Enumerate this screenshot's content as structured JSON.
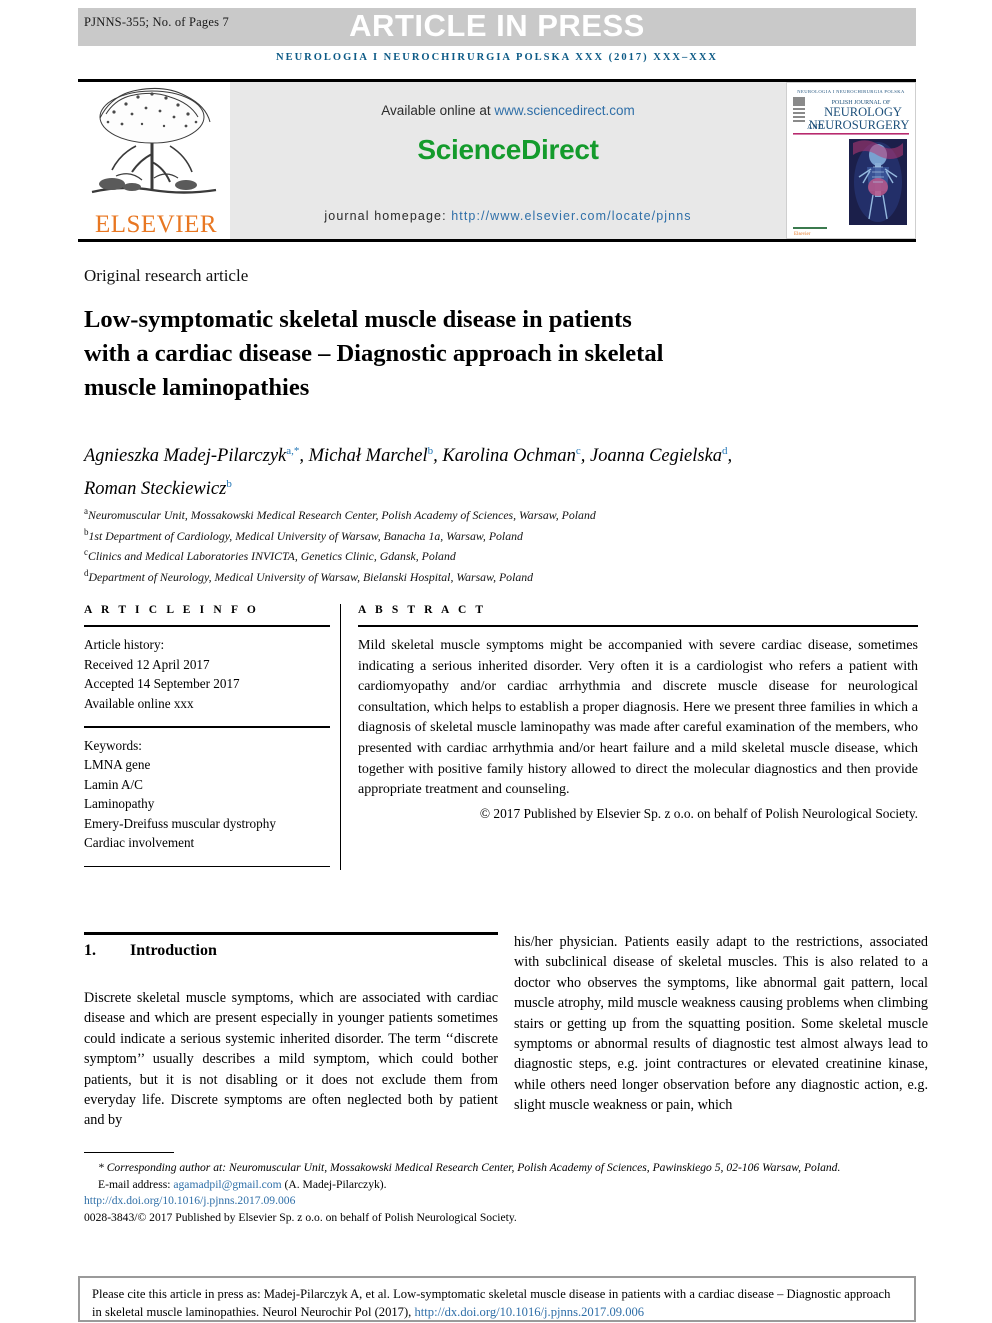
{
  "press_band": {
    "manuscript_id": "PJNNS-355; No. of Pages 7",
    "status": "ARTICLE IN PRESS"
  },
  "running_head": "NEUROLOGIA I NEUROCHIRURGIA POLSKA XXX (2017) XXX–XXX",
  "masthead": {
    "publisher": "ELSEVIER",
    "available_online": "Available online at",
    "sciencedirect_url": "www.sciencedirect.com",
    "sciencedirect_logo": "ScienceDirect",
    "homepage_label": "journal homepage:",
    "homepage_url": "http://www.elsevier.com/locate/pjnns",
    "cover": {
      "top_line": "NEUROLOGIA I NEUROCHIRURGIA POLSKA",
      "line1": "POLISH JOURNAL OF",
      "line2": "NEUROLOGY",
      "line3": "AND",
      "line4": "NEUROSURGERY",
      "footer": "Elsevier"
    }
  },
  "article": {
    "type": "Original research article",
    "title": "Low-symptomatic skeletal muscle disease in patients with a cardiac disease – Diagnostic approach in skeletal muscle laminopathies",
    "authors_line1": "Agnieszka Madej-Pilarczyk",
    "authors": [
      {
        "name": "Agnieszka Madej-Pilarczyk",
        "marks": "a,*"
      },
      {
        "name": "Michał Marchel",
        "marks": "b"
      },
      {
        "name": "Karolina Ochman",
        "marks": "c"
      },
      {
        "name": "Joanna Cegielska",
        "marks": "d"
      },
      {
        "name": "Roman Steckiewicz",
        "marks": "b"
      }
    ],
    "affiliations": [
      {
        "mark": "a",
        "text": "Neuromuscular Unit, Mossakowski Medical Research Center, Polish Academy of Sciences, Warsaw, Poland"
      },
      {
        "mark": "b",
        "text": "1st Department of Cardiology, Medical University of Warsaw, Banacha 1a, Warsaw, Poland"
      },
      {
        "mark": "c",
        "text": "Clinics and Medical Laboratories INVICTA, Genetics Clinic, Gdansk, Poland"
      },
      {
        "mark": "d",
        "text": "Department of Neurology, Medical University of Warsaw, Bielanski Hospital, Warsaw, Poland"
      }
    ]
  },
  "article_info": {
    "heading": "A R T I C L E   I N F O",
    "history_label": "Article history:",
    "received": "Received 12 April 2017",
    "accepted": "Accepted 14 September 2017",
    "available_online": "Available online xxx",
    "keywords_label": "Keywords:",
    "keywords": [
      "LMNA gene",
      "Lamin A/C",
      "Laminopathy",
      "Emery-Dreifuss muscular dystrophy",
      "Cardiac involvement"
    ]
  },
  "abstract": {
    "heading": "A B S T R A C T",
    "text": "Mild skeletal muscle symptoms might be accompanied with severe cardiac disease, sometimes indicating a serious inherited disorder. Very often it is a cardiologist who refers a patient with cardiomyopathy and/or cardiac arrhythmia and discrete muscle disease for neurological consultation, which helps to establish a proper diagnosis. Here we present three families in which a diagnosis of skeletal muscle laminopathy was made after careful examination of the members, who presented with cardiac arrhythmia and/or heart failure and a mild skeletal muscle disease, which together with positive family history allowed to direct the molecular diagnostics and then provide appropriate treatment and counseling.",
    "copyright": "© 2017 Published by Elsevier Sp. z o.o. on behalf of Polish Neurological Society."
  },
  "body": {
    "section_number": "1.",
    "section_title": "Introduction",
    "left_column": "Discrete skeletal muscle symptoms, which are associated with cardiac disease and which are present especially in younger patients sometimes could indicate a serious systemic inherited disorder. The term ‘‘discrete symptom’’ usually describes a mild symptom, which could bother patients, but it is not disabling or it does not exclude them from everyday life. Discrete symptoms are often neglected both by patient and by",
    "right_column": "his/her physician. Patients easily adapt to the restrictions, associated with subclinical disease of skeletal muscles. This is also related to a doctor who observes the symptoms, like abnormal gait pattern, local muscle atrophy, mild muscle weakness causing problems when climbing stairs or getting up from the squatting position. Some skeletal muscle symptoms or abnormal results of diagnostic test almost always lead to diagnostic steps, e.g. joint contractures or elevated creatinine kinase, while others need longer observation before any diagnostic action, e.g. slight muscle weakness or pain, which"
  },
  "footnotes": {
    "corresponding": "Corresponding author at: Neuromuscular Unit, Mossakowski Medical Research Center, Polish Academy of Sciences, Pawinskiego 5, 02-106 Warsaw, Poland.",
    "email_label": "E-mail address:",
    "email": "agamadpil@gmail.com",
    "email_owner": "(A. Madej-Pilarczyk).",
    "doi": "http://dx.doi.org/10.1016/j.pjnns.2017.09.006",
    "issn_line": "0028-3843/© 2017 Published by Elsevier Sp. z o.o. on behalf of Polish Neurological Society."
  },
  "cite_box": {
    "text": "Please cite this article in press as: Madej-Pilarczyk A, et al. Low-symptomatic skeletal muscle disease in patients with a cardiac disease – Diagnostic approach in skeletal muscle laminopathies. Neurol Neurochir Pol (2017),",
    "link": "http://dx.doi.org/10.1016/j.pjnns.2017.09.006"
  },
  "colors": {
    "band_gray": "#c9c9c9",
    "journal_blue": "#0c5a86",
    "link_blue": "#2f6fa8",
    "sciencedirect_green": "#149b2c",
    "elsevier_orange": "#e87722",
    "panel_gray": "#e8e8e8"
  }
}
